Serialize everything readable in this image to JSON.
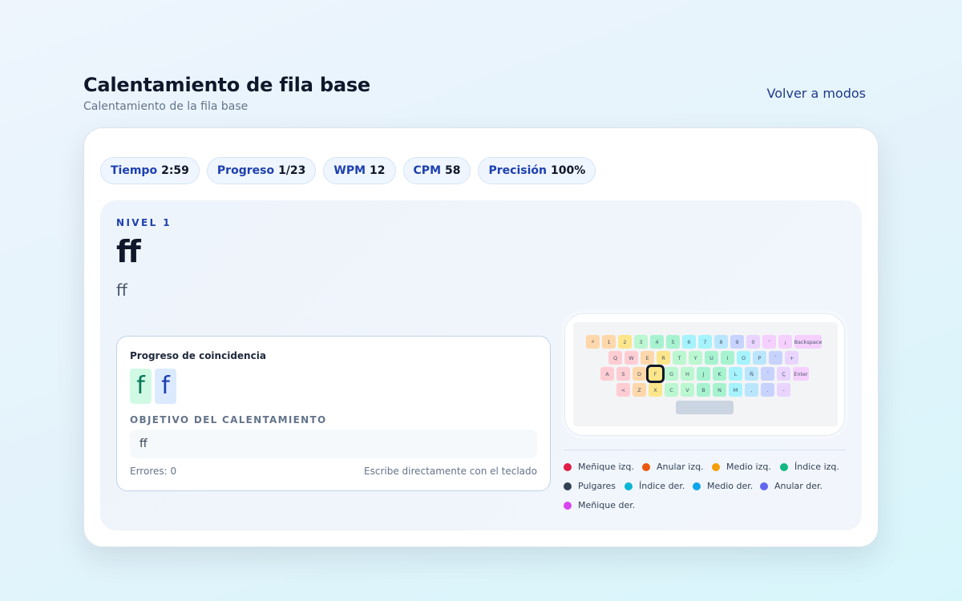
{
  "header": {
    "title": "Calentamiento de fila base",
    "subtitle": "Calentamiento de la fila base",
    "back_label": "Volver a modos"
  },
  "stats": [
    {
      "label": "Tiempo",
      "value": "2:59"
    },
    {
      "label": "Progreso",
      "value": "1/23"
    },
    {
      "label": "WPM",
      "value": "12"
    },
    {
      "label": "CPM",
      "value": "58"
    },
    {
      "label": "Precisión",
      "value": "100%"
    }
  ],
  "exercise": {
    "level": "NIVEL 1",
    "target_big": "ff",
    "target_small": "ff"
  },
  "match": {
    "title": "Progreso de coincidencia",
    "chars": [
      {
        "char": "f",
        "state": "correct"
      },
      {
        "char": "f",
        "state": "current"
      }
    ],
    "objective_label": "OBJETIVO DEL CALENTAMIENTO",
    "objective_value": "ff",
    "errors": "Errores: 0",
    "hint": "Escribe directamente con el teclado"
  },
  "keyboard": {
    "active_key": "F",
    "rows": [
      [
        "º",
        "1",
        "2",
        "3",
        "4",
        "5",
        "6",
        "7",
        "8",
        "9",
        "0",
        "'",
        "¡",
        "Backspace"
      ],
      [
        "Q",
        "W",
        "E",
        "R",
        "T",
        "Y",
        "U",
        "I",
        "O",
        "P",
        "`",
        "+"
      ],
      [
        "A",
        "S",
        "D",
        "F",
        "G",
        "H",
        "J",
        "K",
        "L",
        "Ñ",
        "´",
        "Ç",
        "Enter"
      ],
      [
        "<",
        "Z",
        "X",
        "C",
        "V",
        "B",
        "N",
        "M",
        ",",
        ".",
        "-"
      ]
    ]
  },
  "legend": [
    {
      "label": "Meñique izq.",
      "color": "#e11d48"
    },
    {
      "label": "Anular izq.",
      "color": "#ea580c"
    },
    {
      "label": "Medio izq.",
      "color": "#f59e0b"
    },
    {
      "label": "Índice izq.",
      "color": "#10b981"
    },
    {
      "label": "Pulgares",
      "color": "#334155"
    },
    {
      "label": "Índice der.",
      "color": "#06b6d4"
    },
    {
      "label": "Medio der.",
      "color": "#0ea5e9"
    },
    {
      "label": "Anular der.",
      "color": "#6366f1"
    },
    {
      "label": "Meñique der.",
      "color": "#d946ef"
    }
  ]
}
